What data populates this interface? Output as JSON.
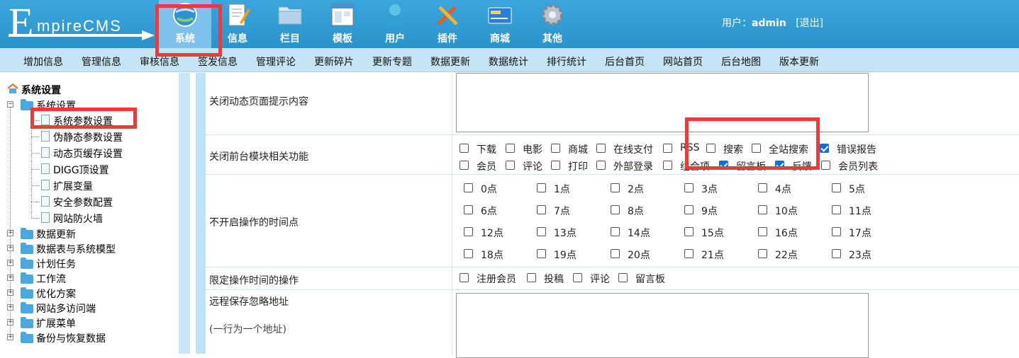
{
  "logo": {
    "first": "E",
    "rest": "mpireCMS"
  },
  "topnav": [
    {
      "label": "系统",
      "icon": "globe-icon",
      "active": true
    },
    {
      "label": "信息",
      "icon": "document-edit-icon"
    },
    {
      "label": "栏目",
      "icon": "folder-icon"
    },
    {
      "label": "模板",
      "icon": "window-icon"
    },
    {
      "label": "用户",
      "icon": "user-icon"
    },
    {
      "label": "插件",
      "icon": "tools-icon"
    },
    {
      "label": "商城",
      "icon": "card-icon"
    },
    {
      "label": "其他",
      "icon": "gear-icon"
    }
  ],
  "user": {
    "prefix": "用户：",
    "name": "admin",
    "logout": "[退出]"
  },
  "subnav": [
    "增加信息",
    "管理信息",
    "审核信息",
    "签发信息",
    "管理评论",
    "更新碎片",
    "更新专题",
    "数据更新",
    "数据统计",
    "排行统计",
    "后台首页",
    "网站首页",
    "后台地图",
    "版本更新"
  ],
  "tree": {
    "root": "系统设置",
    "group": "系统设置",
    "children": [
      "系统参数设置",
      "伪静态参数设置",
      "动态页缓存设置",
      "DIGG顶设置",
      "扩展变量",
      "安全参数配置",
      "网站防火墙"
    ],
    "folders": [
      "数据更新",
      "数据表与系统模型",
      "计划任务",
      "工作流",
      "优化方案",
      "网站多访问端",
      "扩展菜单",
      "备份与恢复数据"
    ]
  },
  "form": {
    "close_tip_label": "关闭动态页面提示内容",
    "close_modules_label": "关闭前台模块相关功能",
    "modules_row1": [
      {
        "label": "下载",
        "checked": false
      },
      {
        "label": "电影",
        "checked": false
      },
      {
        "label": "商城",
        "checked": false
      },
      {
        "label": "在线支付",
        "checked": false
      },
      {
        "label": "RSS",
        "checked": false
      },
      {
        "label": "搜索",
        "checked": false
      },
      {
        "label": "全站搜索",
        "checked": false
      },
      {
        "label": "错误报告",
        "checked": true
      }
    ],
    "modules_row2": [
      {
        "label": "会员",
        "checked": false
      },
      {
        "label": "评论",
        "checked": false
      },
      {
        "label": "打印",
        "checked": false
      },
      {
        "label": "外部登录",
        "checked": false
      },
      {
        "label": "组合项",
        "checked": false
      },
      {
        "label": "留言板",
        "checked": true
      },
      {
        "label": "反馈",
        "checked": true
      },
      {
        "label": "会员列表",
        "checked": false
      }
    ],
    "no_op_time_label": "不开启操作的时间点",
    "hours": [
      "0点",
      "1点",
      "2点",
      "3点",
      "4点",
      "5点",
      "6点",
      "7点",
      "8点",
      "9点",
      "10点",
      "11点",
      "12点",
      "13点",
      "14点",
      "15点",
      "16点",
      "17点",
      "18点",
      "19点",
      "20点",
      "21点",
      "22点",
      "23点"
    ],
    "limit_ops_label": "限定操作时间的操作",
    "limit_ops": [
      "注册会员",
      "投稿",
      "评论",
      "留言板"
    ],
    "remote_ignore_label": "远程保存忽略地址",
    "remote_ignore_hint": "(一行为一个地址)"
  },
  "colors": {
    "header": "#2b93cb",
    "subnav": "#c5e4f5",
    "highlight": "#f03a3a",
    "checked": "#0a6ee4"
  }
}
